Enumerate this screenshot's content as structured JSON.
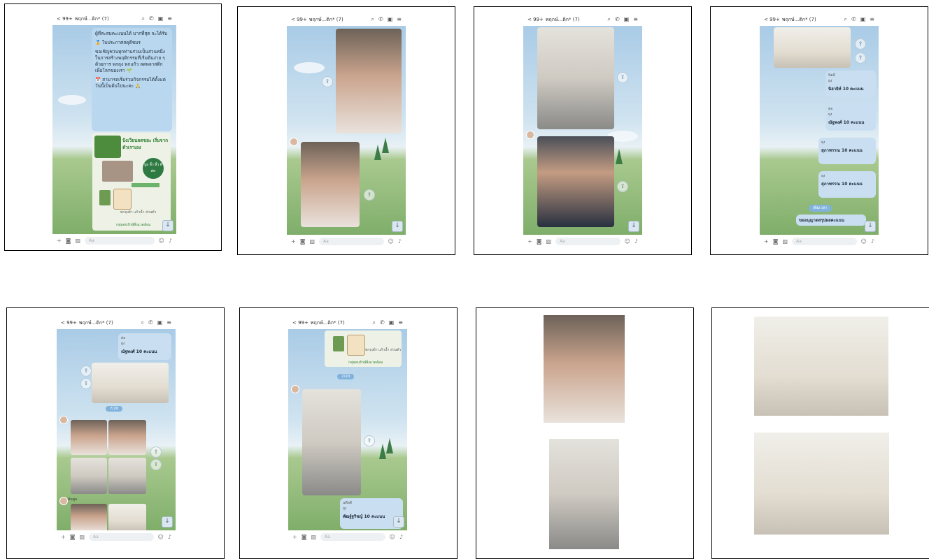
{
  "chat": {
    "back_count": "< 99+",
    "group_name": "พฤกษ์...ติก* (7)",
    "input_placeholder": "Aa"
  },
  "panel1": {
    "message_p1": "ผู้ที่สะสมคะแนนได้ มากที่สุด จะได้รับ",
    "message_p2": "🏅 ใบประกาศสดุดีชมร",
    "message_p3": "ขอเชิญชวนทุกท่านร่วมเป็นส่วนหนึ่งในการสร้างพฤติกรรมที่เริ่มต้นง่าย ๆ ด้วยการ พกถุง พกแก้ว ลดพลาสติก เพื่อโลกของเรา 🌱",
    "message_p4": "📅 สามารถเริ่มร่วมกิจกรรมได้ตั้งแต่วันนี้เป็นต้นไปนะคะ 🙏",
    "poster_heading": "ปังเวียนลดขยะ เริ่มจากตัวเราเอง",
    "poster_badge": "บูธ ลิ้ว ลิ้ว ดีพ่ค",
    "poster_caption": "พกถุงผ้า แก้วน้ำ ส่วนตัว",
    "poster_footer": "กลุ่มคนรักษ์สิ่งแวดล้อม"
  },
  "panel4": {
    "notices": [
      {
        "who": "นิตลี",
        "sub": "ยุง",
        "msg": "นิฮายิห์ 10 คะแนน"
      },
      {
        "who": "ต่อ",
        "sub": "ยุง",
        "msg": "ณัฐพงศ์ 10 คะแนน"
      },
      {
        "who": "",
        "sub": "ยุง",
        "msg": "สุภาพรรณ 10 คะแนน"
      },
      {
        "who": "",
        "sub": "ยุง",
        "msg": "สุภาพรรณ 10 คะแนน"
      }
    ],
    "pill": "เพิ่มเวลา",
    "last_msg": "ขออนุญาตสรุปผลคะแนน"
  },
  "panel5": {
    "notice_who": "ต่อ",
    "notice_sub": "ยุง",
    "notice_msg": "ณัฐพงศ์ 10 คะแนน",
    "pill": "7/20",
    "avatar_label": "ต้นซูล"
  },
  "panel6": {
    "poster_caption": "พกถุงผ้า แก้วน้ำ ส่วนตัว",
    "poster_footer": "กลุ่มคนรักษ์สิ่งแวดล้อม",
    "pill": "7/20",
    "notice_who": "นทีลลี",
    "notice_sub": "ยุง",
    "notice_msg": "พัฒฐ์ฐริชญ์ 10 คะแนน"
  },
  "colors": {
    "bubble": "#b9d7ef",
    "sky": "#a9cbe6",
    "grass": "#7fae6a",
    "border": "#000000"
  }
}
